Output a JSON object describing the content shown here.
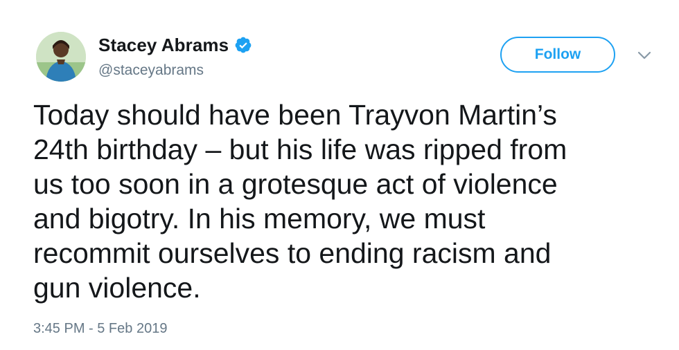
{
  "user": {
    "display_name": "Stacey Abrams",
    "handle": "@staceyabrams",
    "verified": true,
    "verified_icon": "verified-badge-icon",
    "avatar_icon": "user-avatar"
  },
  "actions": {
    "follow_label": "Follow",
    "more_icon": "chevron-down-icon"
  },
  "tweet": {
    "lines": [
      "Today should have been Trayvon Martin’s",
      "24th birthday – but his life was ripped from",
      "us too soon in a grotesque act of violence",
      "and bigotry. In his memory, we must",
      "recommit ourselves to ending racism and",
      "gun violence."
    ],
    "timestamp": "3:45 PM - 5 Feb 2019"
  },
  "colors": {
    "accent": "#1da1f2",
    "text": "#14171a",
    "secondary_text": "#657786"
  }
}
